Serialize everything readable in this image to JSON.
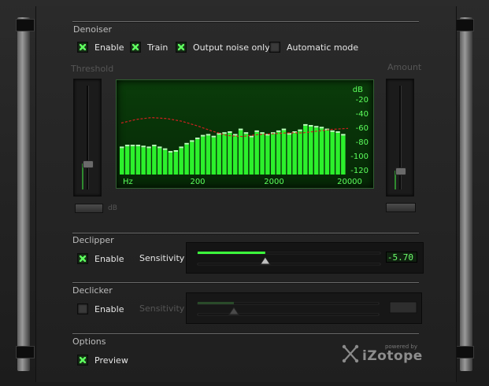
{
  "denoiser": {
    "title": "Denoiser",
    "options": [
      {
        "label": "Enable",
        "checked": true
      },
      {
        "label": "Train",
        "checked": true
      },
      {
        "label": "Output noise only",
        "checked": true
      },
      {
        "label": "Automatic mode",
        "checked": false
      }
    ],
    "threshold": {
      "label": "Threshold",
      "unit": "dB",
      "level": 0.25
    },
    "amount": {
      "label": "Amount",
      "level": 0.18
    }
  },
  "spectrum": {
    "db_unit": "dB",
    "db_ticks": [
      "-20",
      "-40",
      "-60",
      "-80",
      "-100",
      "-120"
    ],
    "freq_unit": "Hz",
    "freq_ticks": [
      "200",
      "2000",
      "20000"
    ],
    "bar_levels": [
      -80,
      -78,
      -78,
      -78,
      -79,
      -80,
      -78,
      -80,
      -82,
      -85,
      -84,
      -80,
      -76,
      -73,
      -70,
      -67,
      -66,
      -68,
      -65,
      -64,
      -63,
      -66,
      -60,
      -64,
      -68,
      -62,
      -64,
      -66,
      -64,
      -62,
      -60,
      -65,
      -63,
      -61,
      -55,
      -56,
      -57,
      -58,
      -60,
      -62,
      -63,
      -66
    ],
    "noise_curve": [
      -52,
      -48,
      -46,
      -47,
      -50,
      -55,
      -61,
      -66,
      -67,
      -65,
      -64,
      -63,
      -63,
      -61,
      -59,
      -58
    ]
  },
  "declipper": {
    "title": "Declipper",
    "enable": {
      "label": "Enable",
      "checked": true
    },
    "sensitivity_label": "Sensitivity",
    "sensitivity_value": "-5.70",
    "slider_level": 0.37
  },
  "declicker": {
    "title": "Declicker",
    "enable": {
      "label": "Enable",
      "checked": false
    },
    "sensitivity_label": "Sensitivity",
    "slider_level": 0.2
  },
  "options": {
    "title": "Options",
    "preview": {
      "label": "Preview",
      "checked": true
    }
  },
  "branding": {
    "powered_by": "powered by",
    "name": "iZotope"
  },
  "colors": {
    "bar_green": "#2cf02c",
    "curve_red": "#d02020",
    "tick_green": "#5dff5d"
  }
}
